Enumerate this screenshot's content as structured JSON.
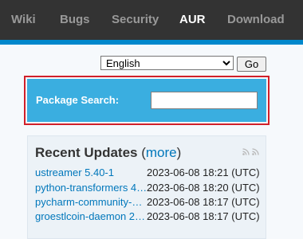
{
  "nav": {
    "items": [
      {
        "label": "Wiki",
        "active": false
      },
      {
        "label": "Bugs",
        "active": false
      },
      {
        "label": "Security",
        "active": false
      },
      {
        "label": "AUR",
        "active": true
      },
      {
        "label": "Download",
        "active": false
      }
    ]
  },
  "language": {
    "selected": "English",
    "go_label": "Go"
  },
  "search": {
    "label": "Package Search:",
    "value": ""
  },
  "updates": {
    "title": "Recent Updates",
    "more_label": "more",
    "rss_icons": [
      "rss-icon",
      "rss-icon"
    ],
    "rows": [
      {
        "package": "ustreamer 5.40-1",
        "date": "2023-06-08 18:21 (UTC)"
      },
      {
        "package": "python-transformers 4…",
        "date": "2023-06-08 18:20 (UTC)"
      },
      {
        "package": "pycharm-community-…",
        "date": "2023-06-08 18:17 (UTC)"
      },
      {
        "package": "groestlcoin-daemon 2…",
        "date": "2023-06-08 18:17 (UTC)"
      }
    ]
  },
  "colors": {
    "topbar": "#333333",
    "accent": "#0088cc",
    "search_bg": "#3aaee0",
    "highlight": "#d0202a",
    "link": "#0077bb"
  }
}
